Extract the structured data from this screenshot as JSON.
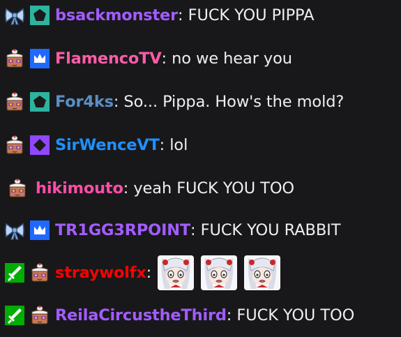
{
  "colors": {
    "background": "#18181b",
    "message_text": "#efeff1",
    "vip_badge": "#e005b9",
    "turbo_badge": "#1f69ff",
    "sub_badge_teal": "#2db39e",
    "sub_badge_purple": "#9147ff",
    "mod_badge": "#00ad03"
  },
  "messages": [
    {
      "username": "bsackmonster",
      "color": "#a35cff",
      "text": "FUCK YOU PIPPA"
    },
    {
      "username": "FlamencoTV",
      "color": "#ff5ca8",
      "text": "no we hear you"
    },
    {
      "username": "For4ks",
      "color": "#5a8fc4",
      "text": "So... Pippa. How's the mold?"
    },
    {
      "username": "SirWenceVT",
      "color": "#1e90ff",
      "text": "lol"
    },
    {
      "username": "hikimouto",
      "color": "#ff4da6",
      "text": "yeah FUCK YOU TOO"
    },
    {
      "username": "TR1GG3RPOINT",
      "color": "#a35cff",
      "text": "FUCK YOU RABBIT"
    },
    {
      "username": "straywolfx",
      "color": "#ff0000",
      "emotes": [
        "pippa-shocked-emote",
        "pippa-shocked-emote",
        "pippa-shocked-emote"
      ]
    },
    {
      "username": "ReilaCircustheThird",
      "color": "#a35cff",
      "text": "FUCK YOU TOO"
    }
  ],
  "colon": ":"
}
